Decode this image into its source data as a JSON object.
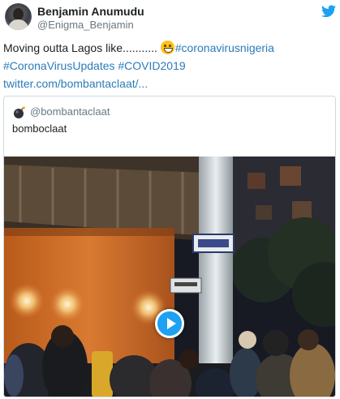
{
  "author": {
    "name": "Benjamin Anumudu",
    "handle": "@Enigma_Benjamin"
  },
  "tweet": {
    "text_plain": "Moving outta Lagos like...........",
    "emoji": "grinning-face-emoji",
    "hashtag_1": "#coronavirusnigeria",
    "hashtag_2": "#CoronaVirusUpdates",
    "hashtag_3": "#COVID2019",
    "link": "twitter.com/bombantaclaat/..."
  },
  "quoted": {
    "icon": "bomb-icon",
    "handle": "@bombantaclaat",
    "text": "bomboclaat",
    "media": "video-thumbnail",
    "play_icon": "play-icon"
  },
  "colors": {
    "link": "#2b7bb9",
    "secondary_text": "#697882",
    "twitter_blue": "#1da1f2",
    "border": "#cfd9de"
  }
}
